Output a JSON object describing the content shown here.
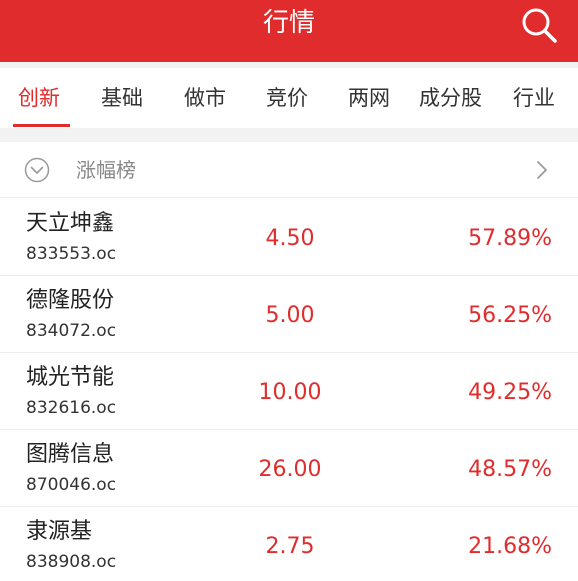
{
  "header": {
    "title": "行情",
    "search_icon": "search-icon"
  },
  "tabs": [
    {
      "label": "创新",
      "active": true
    },
    {
      "label": "基础",
      "active": false
    },
    {
      "label": "做市",
      "active": false
    },
    {
      "label": "竞价",
      "active": false
    },
    {
      "label": "两网",
      "active": false
    },
    {
      "label": "成分股",
      "active": false
    },
    {
      "label": "行业",
      "active": false
    }
  ],
  "section": {
    "title": "涨幅榜",
    "collapse_icon": "chevron-down-circle-icon",
    "more_icon": "chevron-right-icon"
  },
  "stocks": [
    {
      "name": "天立坤鑫",
      "code": "833553.oc",
      "price": "4.50",
      "change": "57.89%"
    },
    {
      "name": "德隆股份",
      "code": "834072.oc",
      "price": "5.00",
      "change": "56.25%"
    },
    {
      "name": "城光节能",
      "code": "832616.oc",
      "price": "10.00",
      "change": "49.25%"
    },
    {
      "name": "图腾信息",
      "code": "870046.oc",
      "price": "26.00",
      "change": "48.57%"
    },
    {
      "name": "隶源基",
      "code": "838908.oc",
      "price": "2.75",
      "change": "21.68%"
    }
  ],
  "colors": {
    "brand_red": "#e02c2c",
    "up_red": "#e02c2c",
    "background": "#ffffff",
    "divider": "#f2f2f2"
  }
}
